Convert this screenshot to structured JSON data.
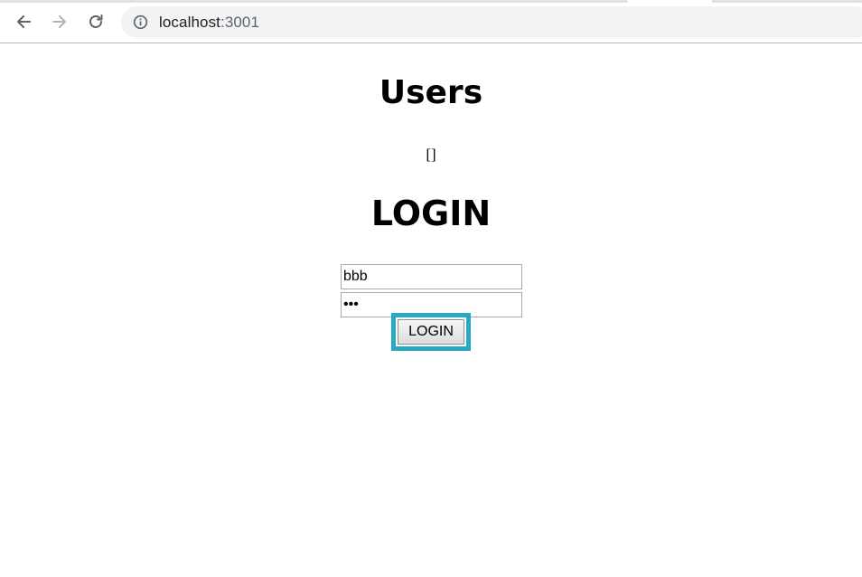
{
  "browser": {
    "url_host": "localhost",
    "url_port": ":3001",
    "icons": {
      "back": "back-arrow-icon",
      "forward": "forward-arrow-icon",
      "reload": "reload-icon",
      "site_info": "info-icon"
    }
  },
  "page": {
    "users_title": "Users",
    "users_list": "[]",
    "login_title": "LOGIN",
    "username_value": "bbb",
    "password_value": "aaa",
    "login_button_label": "LOGIN"
  },
  "colors": {
    "highlight_border": "#29a8c4",
    "omnibox_bg": "#f1f3f4"
  }
}
